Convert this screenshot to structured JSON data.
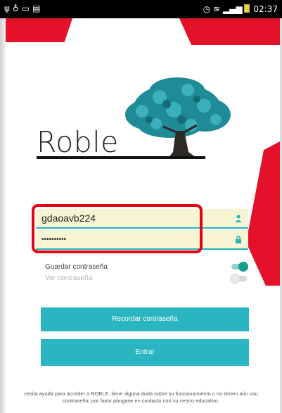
{
  "status_bar": {
    "left_icons": [
      "usb-icon",
      "location-icon",
      "cast-icon",
      "image-icon"
    ],
    "right_icons": [
      "alarm-icon",
      "wifi-icon",
      "signal-icon",
      "battery-icon"
    ],
    "time": "02:37"
  },
  "brand": {
    "logo_text": "Roble",
    "accent_color": "#e4112a",
    "tree_color": "#1f8b97"
  },
  "form": {
    "username_value": "gdaoavb224",
    "password_value": "••••••••••",
    "field_bg_color": "#f6f4d3",
    "save_password_label": "Guardar contraseña",
    "save_password_on": true,
    "show_password_label": "Ver contraseña",
    "show_password_on": false
  },
  "buttons": {
    "remind_password": "Recordar contraseña",
    "enter": "Entrar",
    "color": "#2bb5c0"
  },
  "footer": {
    "line1": "cesita ayuda para acceder a ROBLE, tiene alguna duda sobre su funcionamiento o no tienen aún usu",
    "line2": "contraseña, por favor póngase en contacto con su centro educativo."
  }
}
